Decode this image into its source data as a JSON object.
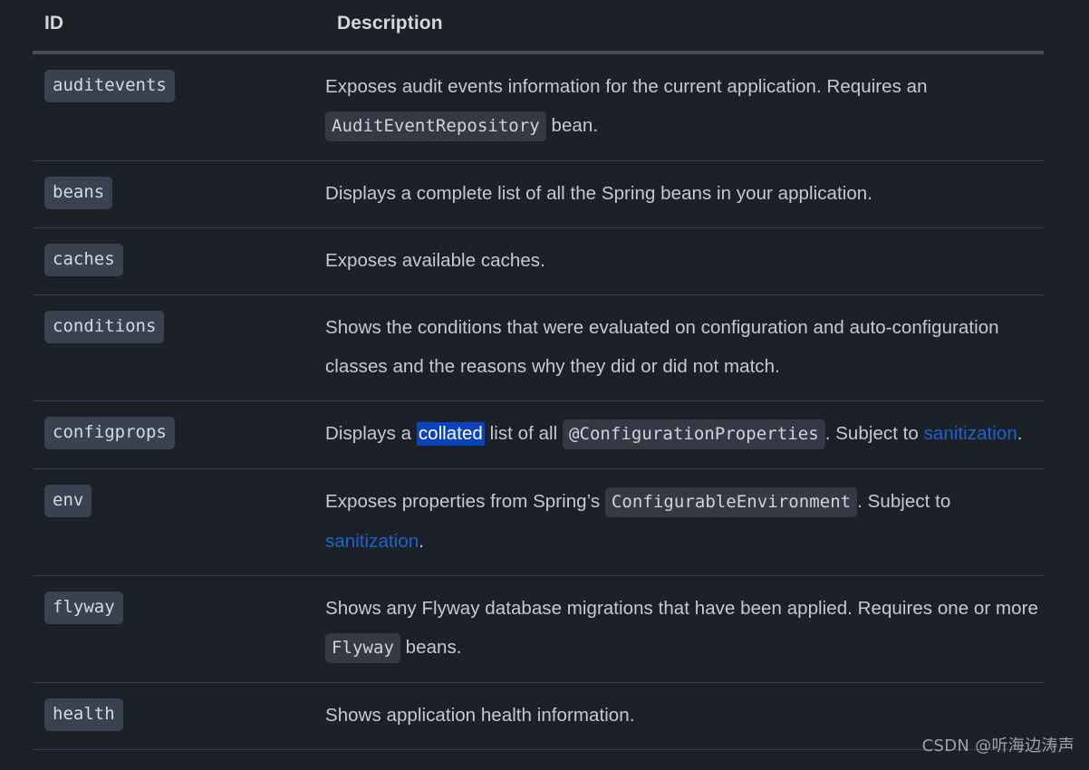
{
  "table": {
    "columns": [
      {
        "key": "id",
        "label": "ID"
      },
      {
        "key": "description",
        "label": "Description"
      }
    ],
    "rows": [
      {
        "id": "auditevents",
        "description_plain": "Exposes audit events information for the current application. Requires an AuditEventRepository bean.",
        "parts": [
          {
            "type": "text",
            "text": "Exposes audit events information for the current application. Requires an "
          },
          {
            "type": "code",
            "text": "AuditEventRepository"
          },
          {
            "type": "text",
            "text": " bean."
          }
        ]
      },
      {
        "id": "beans",
        "description_plain": "Displays a complete list of all the Spring beans in your application.",
        "parts": [
          {
            "type": "text",
            "text": "Displays a complete list of all the Spring beans in your application."
          }
        ]
      },
      {
        "id": "caches",
        "description_plain": "Exposes available caches.",
        "parts": [
          {
            "type": "text",
            "text": "Exposes available caches."
          }
        ]
      },
      {
        "id": "conditions",
        "description_plain": "Shows the conditions that were evaluated on configuration and auto-configuration classes and the reasons why they did or did not match.",
        "parts": [
          {
            "type": "text",
            "text": "Shows the conditions that were evaluated on configuration and auto-configuration classes and the reasons why they did or did not match."
          }
        ]
      },
      {
        "id": "configprops",
        "description_plain": "Displays a collated list of all @ConfigurationProperties. Subject to sanitization.",
        "parts": [
          {
            "type": "text",
            "text": "Displays a "
          },
          {
            "type": "selected",
            "text": "collated"
          },
          {
            "type": "text",
            "text": " list of all "
          },
          {
            "type": "code",
            "text": "@ConfigurationProperties"
          },
          {
            "type": "text",
            "text": ". Subject to "
          },
          {
            "type": "link",
            "text": "sanitization"
          },
          {
            "type": "text",
            "text": "."
          }
        ]
      },
      {
        "id": "env",
        "description_plain": "Exposes properties from Spring’s ConfigurableEnvironment. Subject to sanitization.",
        "parts": [
          {
            "type": "text",
            "text": "Exposes properties from Spring’s "
          },
          {
            "type": "code",
            "text": "ConfigurableEnvironment"
          },
          {
            "type": "text",
            "text": ". Subject to "
          },
          {
            "type": "link",
            "text": "sanitization"
          },
          {
            "type": "text",
            "text": "."
          }
        ]
      },
      {
        "id": "flyway",
        "description_plain": "Shows any Flyway database migrations that have been applied. Requires one or more Flyway beans.",
        "parts": [
          {
            "type": "text",
            "text": "Shows any Flyway database migrations that have been applied. Requires one or more "
          },
          {
            "type": "code",
            "text": "Flyway"
          },
          {
            "type": "text",
            "text": " beans."
          }
        ]
      },
      {
        "id": "health",
        "description_plain": "Shows application health information.",
        "parts": [
          {
            "type": "text",
            "text": "Shows application health information."
          }
        ]
      }
    ]
  },
  "watermark": {
    "text": "CSDN @听海边涛声"
  },
  "colors": {
    "background": "#1c2027",
    "body_text": "#c6cad0",
    "header_text": "#d4d7dc",
    "id_chip_bg": "#3a4150",
    "code_chip_bg": "#333a45",
    "link": "#1e63d0",
    "selection_bg": "#0b42be",
    "selection_text": "#ffffff",
    "divider": "#3a414b",
    "header_rule": "#474e58"
  }
}
